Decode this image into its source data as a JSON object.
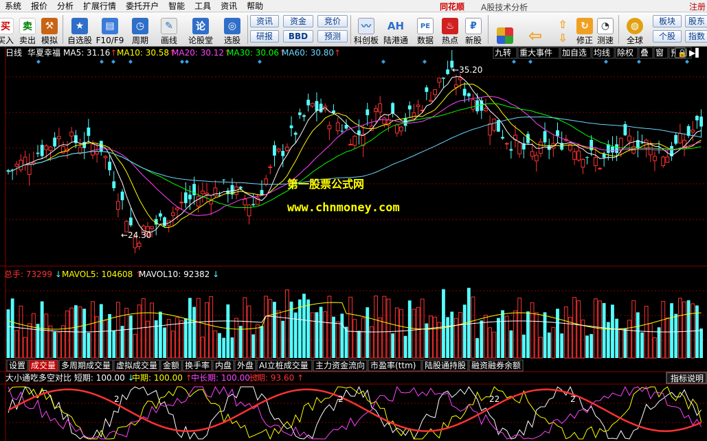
{
  "menu": {
    "items": [
      "系统",
      "报价",
      "分析",
      "扩展行情",
      "委托开户",
      "智能",
      "工具",
      "资讯",
      "帮助"
    ],
    "brand": "同花顺",
    "app_title": "A股技术分析",
    "right_label": "注册"
  },
  "toolbar": {
    "buy": "买入",
    "sell": "卖出",
    "buy_icon": "买",
    "sell_icon": "卖",
    "simulate": "模拟",
    "watchlist": "自选股",
    "f10": "F10/F9",
    "period": "周期",
    "draw": "画线",
    "forum": "论股堂",
    "picker": "选股",
    "forum_icon": "论",
    "zixun": "资讯",
    "zijin": "资金",
    "jingjia": "竞价",
    "yanbao": "研报",
    "bbd": "BBD",
    "yuce": "预测",
    "kechuang": "科创板",
    "lugangtong": "陆港通",
    "lugangtong_icon": "AH",
    "shuju": "数据",
    "shuju_icon": "PE",
    "redian": "热点",
    "xingu": "新股",
    "xiuzheng": "修正",
    "cesu": "测速",
    "quanqiu": "全球",
    "bankuai": "板块",
    "gegu": "个股",
    "gudong": "股东",
    "zhishu": "指数"
  },
  "stock": {
    "period": "日线",
    "name": "华夏幸福",
    "ma": [
      {
        "label": "MA5:",
        "value": "31.16",
        "arrow": "↑",
        "color": "#ffffff"
      },
      {
        "label": "MA10:",
        "value": "30.58",
        "arrow": "↑",
        "color": "#ffff00"
      },
      {
        "label": "MA20:",
        "value": "30.12",
        "arrow": "↑",
        "color": "#ff44ff"
      },
      {
        "label": "MA30:",
        "value": "30.06",
        "arrow": "↑",
        "color": "#00ff00"
      },
      {
        "label": "MA60:",
        "value": "30.80",
        "arrow": "↑",
        "color": "#6ad8ff"
      }
    ],
    "high_label": "35.20",
    "low_label": "24.30",
    "right_tools": [
      "九转",
      "重大事件",
      "加自选",
      "均线",
      "除权",
      "叠",
      "窗",
      "预测"
    ]
  },
  "watermark": {
    "line1": "第一股票公式网",
    "line2": "www.chnmoney.com"
  },
  "volume": {
    "total": {
      "label": "总手:",
      "value": "73299",
      "arrow": "↓"
    },
    "mavol5": {
      "label": "MAVOL5:",
      "value": "104608",
      "arrow": "↑"
    },
    "mavol10": {
      "label": "MAVOL10:",
      "value": "92382",
      "arrow": "↓"
    }
  },
  "tabs": [
    "设置",
    "成交量",
    "多周期成交量",
    "虚拟成交量",
    "金额",
    "换手率",
    "内盘",
    "外盘",
    "AI立桩成交量",
    "主力资金流向",
    "市盈率(ttm)",
    "陆股通持股",
    "融资融券余额"
  ],
  "active_tab": 1,
  "indicator": {
    "name": "大小通吃多空对比",
    "short": {
      "label": "短期:",
      "value": "100.00",
      "arrow": "↓"
    },
    "mid": {
      "label": "中期:",
      "value": "100.00",
      "arrow": "↑"
    },
    "midlong": {
      "label": "中长期:",
      "value": "100.00",
      "arrow": "↑"
    },
    "long": {
      "label": "长期:",
      "value": "93.60",
      "arrow": "↑"
    },
    "help": "指标说明",
    "marks": [
      "2",
      "2",
      "22",
      "2"
    ]
  },
  "colors": {
    "up": "#ff3232",
    "down": "#54ffff",
    "ma5": "#ffffff",
    "ma10": "#ffff00",
    "ma20": "#ff44ff",
    "ma30": "#00ff00",
    "ma60": "#6ad8ff",
    "grid": "#8b0000",
    "watermark": "#ffff00"
  }
}
